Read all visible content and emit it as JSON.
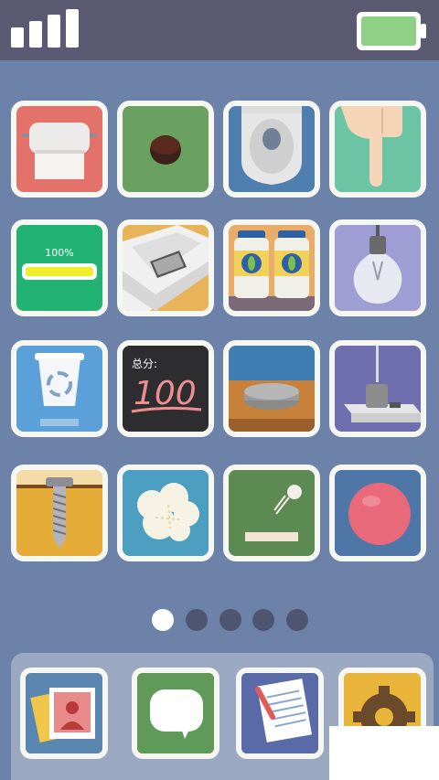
{
  "status_bar": {
    "signal_icon": "signal-bars-icon",
    "battery_icon": "battery-icon",
    "battery_color": "#8fcf86"
  },
  "home_grid": {
    "apps": [
      {
        "name": "toilet-paper-app",
        "bg": "#e2726a"
      },
      {
        "name": "hole-app",
        "bg": "#6aa060"
      },
      {
        "name": "toilet-app",
        "bg": "#4e7fae"
      },
      {
        "name": "finger-app",
        "bg": "#6cc4a4"
      },
      {
        "name": "battery-app",
        "bg": "#22b374",
        "battery_text": "100%"
      },
      {
        "name": "phone-in-box-app",
        "bg": "#e8b45a"
      },
      {
        "name": "pickle-jars-app",
        "bg": "#e9ad6a"
      },
      {
        "name": "light-bulb-app",
        "bg": "#9f9ed4"
      },
      {
        "name": "recycle-bin-app",
        "bg": "#5ba0d8"
      },
      {
        "name": "score-board-app",
        "bg": "#2e2e30",
        "score_label": "总分:",
        "score_value": "100"
      },
      {
        "name": "stone-disc-app",
        "bg": "#3f7db2"
      },
      {
        "name": "power-strip-app",
        "bg": "#6f6fb0"
      },
      {
        "name": "screw-app",
        "bg": "#e5ac38"
      },
      {
        "name": "popcorn-app",
        "bg": "#4c9fc0"
      },
      {
        "name": "pong-app",
        "bg": "#5c8a52"
      },
      {
        "name": "red-ball-app",
        "bg": "#4e77a8"
      }
    ]
  },
  "page_indicator": {
    "total_pages": 5,
    "current_page": 1
  },
  "dock": {
    "apps": [
      {
        "name": "photos-app",
        "bg": "#5b86b0"
      },
      {
        "name": "messages-app",
        "bg": "#5f9a58"
      },
      {
        "name": "notes-app",
        "bg": "#5a6aa8"
      },
      {
        "name": "settings-app",
        "bg": "#e8b53a"
      }
    ]
  }
}
